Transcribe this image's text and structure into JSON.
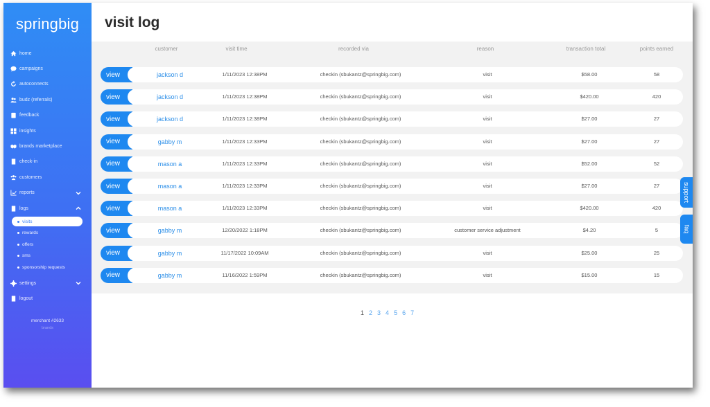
{
  "sidebar": {
    "brand": "springbig",
    "items": [
      {
        "label": "home",
        "icon": "home-icon"
      },
      {
        "label": "campaigns",
        "icon": "chat-bubble-icon"
      },
      {
        "label": "autoconnects",
        "icon": "refresh-icon"
      },
      {
        "label": "budz (referrals)",
        "icon": "users-icon"
      },
      {
        "label": "feedback",
        "icon": "clipboard-icon"
      },
      {
        "label": "insights",
        "icon": "grid-icon"
      },
      {
        "label": "brands marketplace",
        "icon": "handshake-icon"
      },
      {
        "label": "check-in",
        "icon": "door-icon"
      },
      {
        "label": "customers",
        "icon": "group-icon"
      },
      {
        "label": "reports",
        "icon": "chart-icon"
      },
      {
        "label": "logs",
        "icon": "book-icon"
      }
    ],
    "logs_sub": [
      "visits",
      "rewards",
      "offers",
      "sms",
      "sponsorship requests"
    ],
    "bottom_items": [
      {
        "label": "settings",
        "icon": "gear-icon"
      },
      {
        "label": "logout",
        "icon": "door-icon"
      }
    ],
    "merchant": "merchant #2633",
    "merchant_sub": "brands"
  },
  "page": {
    "title": "visit log"
  },
  "table": {
    "headers": [
      "customer",
      "visit time",
      "recorded via",
      "reason",
      "transaction total",
      "points earned"
    ],
    "view_label": "view",
    "rows": [
      {
        "customer": "jackson d",
        "time": "1/11/2023 12:38PM",
        "via": "checkin (sbukantz@springbig.com)",
        "reason": "visit",
        "total": "$58.00",
        "points": "58"
      },
      {
        "customer": "jackson d",
        "time": "1/11/2023 12:38PM",
        "via": "checkin (sbukantz@springbig.com)",
        "reason": "visit",
        "total": "$420.00",
        "points": "420"
      },
      {
        "customer": "jackson d",
        "time": "1/11/2023 12:38PM",
        "via": "checkin (sbukantz@springbig.com)",
        "reason": "visit",
        "total": "$27.00",
        "points": "27"
      },
      {
        "customer": "gabby m",
        "time": "1/11/2023 12:33PM",
        "via": "checkin (sbukantz@springbig.com)",
        "reason": "visit",
        "total": "$27.00",
        "points": "27"
      },
      {
        "customer": "mason a",
        "time": "1/11/2023 12:33PM",
        "via": "checkin (sbukantz@springbig.com)",
        "reason": "visit",
        "total": "$52.00",
        "points": "52"
      },
      {
        "customer": "mason a",
        "time": "1/11/2023 12:33PM",
        "via": "checkin (sbukantz@springbig.com)",
        "reason": "visit",
        "total": "$27.00",
        "points": "27"
      },
      {
        "customer": "mason a",
        "time": "1/11/2023 12:33PM",
        "via": "checkin (sbukantz@springbig.com)",
        "reason": "visit",
        "total": "$420.00",
        "points": "420"
      },
      {
        "customer": "gabby m",
        "time": "12/20/2022 1:18PM",
        "via": "checkin (sbukantz@springbig.com)",
        "reason": "customer service adjustment",
        "total": "$4.20",
        "points": "5"
      },
      {
        "customer": "gabby m",
        "time": "11/17/2022 10:09AM",
        "via": "checkin (sbukantz@springbig.com)",
        "reason": "visit",
        "total": "$25.00",
        "points": "25"
      },
      {
        "customer": "gabby m",
        "time": "11/16/2022 1:59PM",
        "via": "checkin (sbukantz@springbig.com)",
        "reason": "visit",
        "total": "$15.00",
        "points": "15"
      }
    ]
  },
  "pagination": {
    "pages": [
      "1",
      "2",
      "3",
      "4",
      "5",
      "6",
      "7"
    ],
    "current": "1"
  },
  "tabs": {
    "support": "support",
    "faq": "faq"
  },
  "colors": {
    "accent": "#1e88f0",
    "sidebar_top": "#2f8df5",
    "sidebar_bottom": "#5a4ef0"
  }
}
